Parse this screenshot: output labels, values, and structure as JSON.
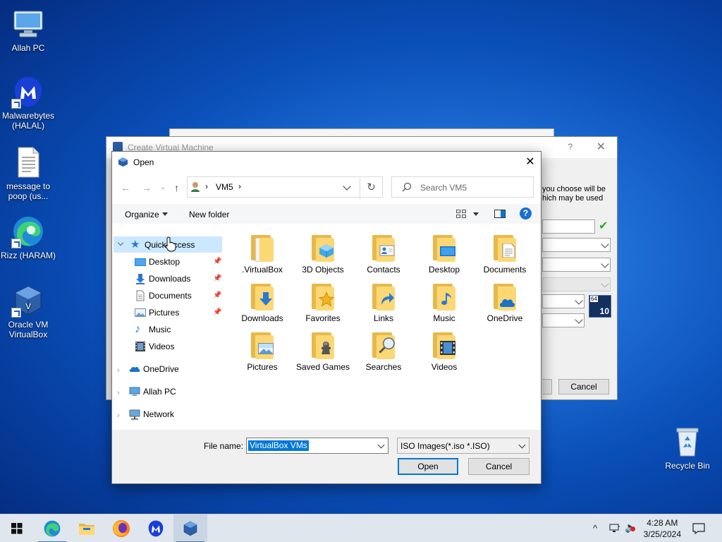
{
  "desktop": {
    "icons": [
      {
        "label": "Allah PC"
      },
      {
        "label": "Malwarebytes (HALAL)"
      },
      {
        "label": "message to poop (us..."
      },
      {
        "label": "Rizz (HARAM)"
      },
      {
        "label": "Oracle VM VirtualBox"
      },
      {
        "label": "Recycle Bin"
      }
    ]
  },
  "background_dialog": {
    "title": "Create Virtual Machine",
    "help": "?",
    "text_line1": "you choose will be",
    "text_line2": "hich may be used",
    "cancel_label": "Cancel",
    "os_badge_top": "64",
    "os_badge_num": "10"
  },
  "open_dialog": {
    "title": "Open",
    "breadcrumb": {
      "sep1": "›",
      "folder": "VM5",
      "sep2": "›"
    },
    "search_placeholder": "Search VM5",
    "toolbar": {
      "organize": "Organize",
      "new_folder": "New folder",
      "help": "?"
    },
    "nav": {
      "quick_access": "Quick access",
      "desktop": "Desktop",
      "downloads": "Downloads",
      "documents": "Documents",
      "pictures": "Pictures",
      "music": "Music",
      "videos": "Videos",
      "onedrive": "OneDrive",
      "this_pc": "Allah PC",
      "network": "Network"
    },
    "files": [
      {
        "label": ".VirtualBox"
      },
      {
        "label": "3D Objects"
      },
      {
        "label": "Contacts"
      },
      {
        "label": "Desktop"
      },
      {
        "label": "Documents"
      },
      {
        "label": "Downloads"
      },
      {
        "label": "Favorites"
      },
      {
        "label": "Links"
      },
      {
        "label": "Music"
      },
      {
        "label": "OneDrive"
      },
      {
        "label": "Pictures"
      },
      {
        "label": "Saved Games"
      },
      {
        "label": "Searches"
      },
      {
        "label": "Videos"
      }
    ],
    "file_name_label": "File name:",
    "file_name_value": "VirtualBox VMs",
    "file_type": "ISO Images(*.iso *.ISO)",
    "open_button": "Open",
    "cancel_button": "Cancel"
  },
  "taskbar": {
    "time": "4:28 AM",
    "date": "3/25/2024",
    "tray_chevron": "^"
  }
}
